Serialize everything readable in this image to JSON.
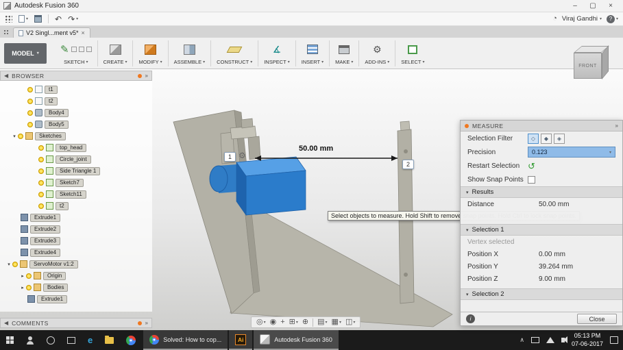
{
  "app": {
    "title": "Autodesk Fusion 360"
  },
  "qat": {
    "user": "Viraj Gandhi"
  },
  "tabs": {
    "doc": "V2 Singl...ment v5*"
  },
  "ribbon": {
    "workspace": "MODEL",
    "groups": [
      {
        "label": "SKETCH"
      },
      {
        "label": "CREATE"
      },
      {
        "label": "MODIFY"
      },
      {
        "label": "ASSEMBLE"
      },
      {
        "label": "CONSTRUCT"
      },
      {
        "label": "INSPECT"
      },
      {
        "label": "INSERT"
      },
      {
        "label": "MAKE"
      },
      {
        "label": "ADD-INS"
      },
      {
        "label": "SELECT"
      }
    ]
  },
  "viewcube": {
    "front_label": "FRONT"
  },
  "browser": {
    "title": "BROWSER",
    "items": [
      {
        "label": "t1"
      },
      {
        "label": "t2"
      },
      {
        "label": "Body4"
      },
      {
        "label": "Body5"
      },
      {
        "label": "Sketches"
      },
      {
        "label": "top_head"
      },
      {
        "label": "Circle_joint"
      },
      {
        "label": "Side Triangle 1"
      },
      {
        "label": "Sketch7"
      },
      {
        "label": "Sketch11"
      },
      {
        "label": "t2"
      },
      {
        "label": "Extrude1"
      },
      {
        "label": "Extrude2"
      },
      {
        "label": "Extrude3"
      },
      {
        "label": "Extrude4"
      },
      {
        "label": "ServoMotor v1:2"
      },
      {
        "label": "Origin"
      },
      {
        "label": "Bodies"
      },
      {
        "label": "Extrude1"
      }
    ]
  },
  "comments": {
    "title": "COMMENTS"
  },
  "scene": {
    "dimension": "50.00 mm",
    "badge1": "1",
    "badge2": "2",
    "tooltip": "Select objects to measure. Hold Shift to remove snap points. Hold Ctrl to lock snap points."
  },
  "measure": {
    "title": "MEASURE",
    "selection_filter_label": "Selection Filter",
    "precision_label": "Precision",
    "precision_value": "0.123",
    "restart_label": "Restart Selection",
    "snap_label": "Show Snap Points",
    "results_title": "Results",
    "distance_label": "Distance",
    "distance_value": "50.00 mm",
    "selection1_title": "Selection 1",
    "selection1_status": "Vertex selected",
    "posx_label": "Position X",
    "posx_value": "0.00 mm",
    "posy_label": "Position Y",
    "posy_value": "39.264 mm",
    "posz_label": "Position Z",
    "posz_value": "9.00 mm",
    "selection2_title": "Selection 2",
    "close_label": "Close"
  },
  "taskbar": {
    "chrome_window": "Solved: How to cop...",
    "ai_label": "Ai",
    "fusion_window": "Autodesk Fusion 360",
    "time": "05:13 PM",
    "date": "07-06-2017"
  },
  "icons": {
    "collapse_left": "◀",
    "more": "»",
    "dd": "▾",
    "tree_open": "▾",
    "tree_closed": "▸",
    "undo": "↶",
    "redo": "↷",
    "gear": "⚙",
    "restart": "↺",
    "close_x": "×",
    "win_min": "–",
    "win_max": "▢",
    "clock": "◔",
    "help": "?",
    "pencil": "✎",
    "angle": "∡",
    "orbit": "◎",
    "look": "◉",
    "pan": "+",
    "zoomwin": "⊞",
    "zoom": "⊕",
    "display": "▤",
    "grid": "▦",
    "views": "◫",
    "chevron_up": "∧",
    "info": "i",
    "filter1": "◇",
    "filter2": "◆",
    "filter3": "◈",
    "edge": "e"
  }
}
